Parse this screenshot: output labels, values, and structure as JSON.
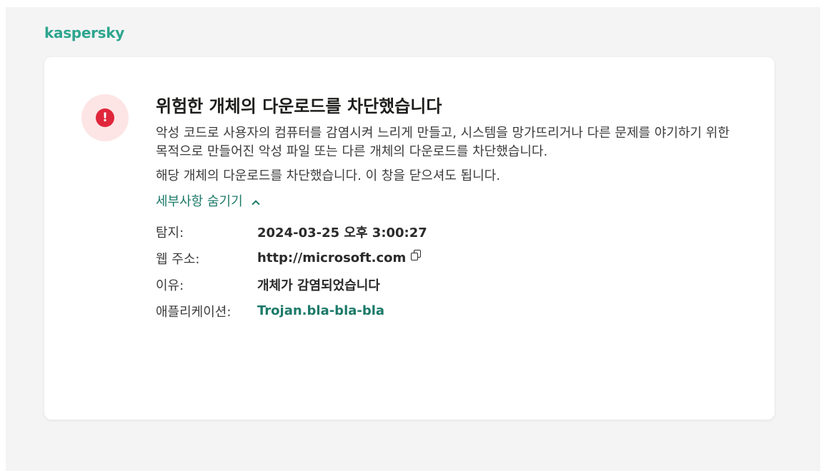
{
  "brand": {
    "logo_text": "kaspersky",
    "accent_color": "#2da58e"
  },
  "alert": {
    "icon": "alert-exclamation-icon",
    "icon_glyph": "!",
    "icon_color": "#e0263b",
    "title": "위험한 개체의 다운로드를 차단했습니다",
    "description": "악성 코드로 사용자의 컴퓨터를 감염시켜 느리게 만들고, 시스템을 망가뜨리거나 다른 문제를 야기하기 위한 목적으로 만들어진 악성 파일 또는 다른 개체의 다운로드를 차단했습니다.",
    "note": "해당 개체의 다운로드를 차단했습니다. 이 창을 닫으셔도 됩니다.",
    "details_toggle_label": "세부사항 숨기기"
  },
  "details": {
    "detected": {
      "label": "탐지:",
      "value": "2024-03-25 오후 3:00:27"
    },
    "web_address": {
      "label": "웹 주소:",
      "value": "http://microsoft.com",
      "copy_icon": "copy-icon"
    },
    "reason": {
      "label": "이유:",
      "value": "개체가 감염되었습니다"
    },
    "application": {
      "label": "애플리케이션:",
      "value": "Trojan.bla-bla-bla"
    }
  }
}
